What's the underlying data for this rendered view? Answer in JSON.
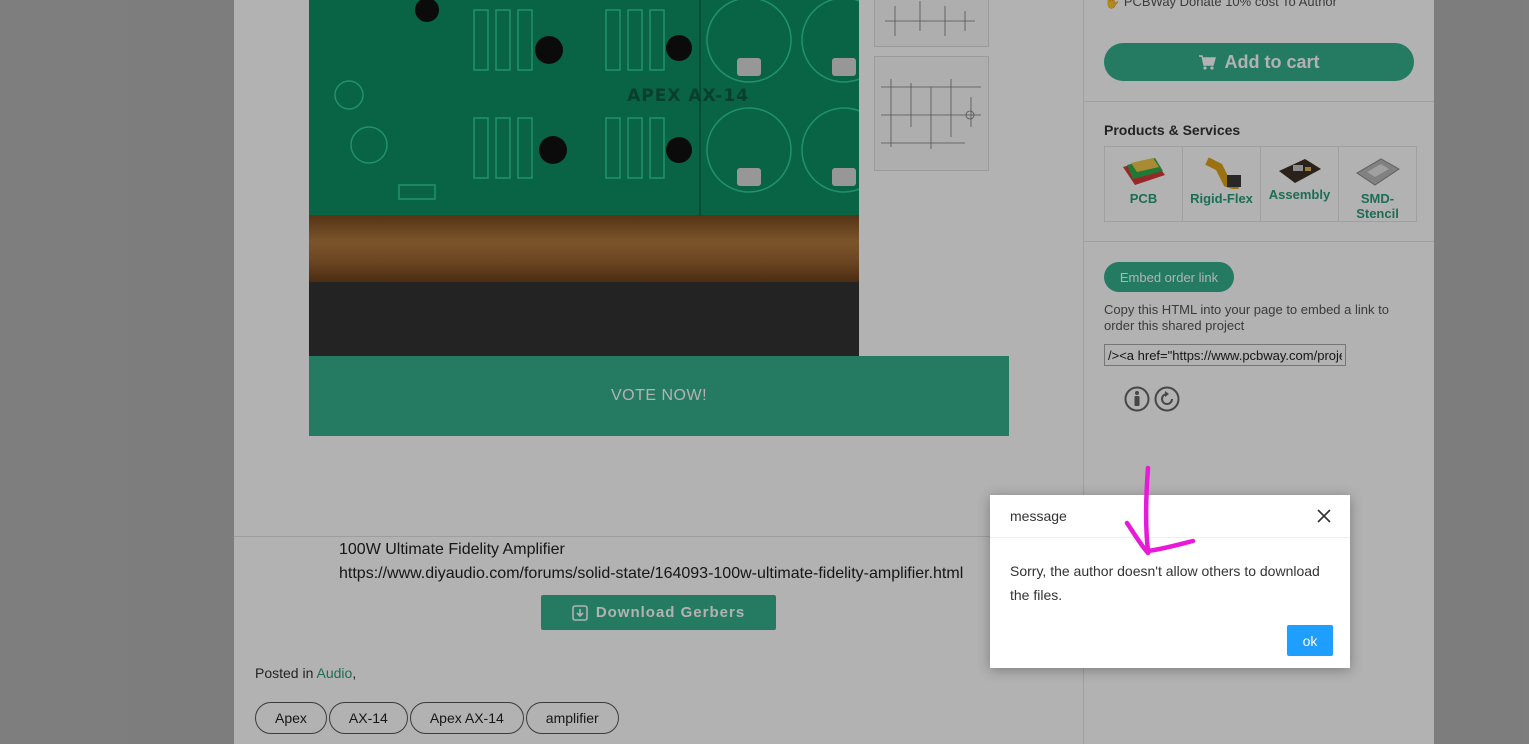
{
  "main": {
    "pcb_silk_text": "APEX AX-14",
    "vote_label": "VOTE NOW!",
    "description_title": "100W Ultimate Fidelity Amplifier",
    "description_link": "https://www.diyaudio.com/forums/solid-state/164093-100w-ultimate-fidelity-amplifier.html",
    "download_label": "Download Gerbers",
    "posted_prefix": "Posted in",
    "posted_category": "Audio",
    "posted_suffix": ",",
    "tags": [
      "Apex",
      "AX-14",
      "Apex AX-14",
      "amplifier"
    ]
  },
  "sidebar": {
    "donate_text": "PCBWay Donate 10% cost To Author",
    "add_to_cart": "Add to cart",
    "products_title": "Products & Services",
    "products": [
      {
        "label": "PCB",
        "icon": "pcb-board-icon"
      },
      {
        "label": "Rigid-Flex",
        "icon": "rigid-flex-icon"
      },
      {
        "label": "Assembly",
        "icon": "assembly-icon"
      },
      {
        "label": "SMD-Stencil",
        "icon": "smd-stencil-icon"
      }
    ],
    "embed_label": "Embed order link",
    "embed_note": "Copy this HTML into your page to embed a link to order this shared project",
    "embed_value": "/><a href=\"https://www.pcbway.com/project/shareproject/"
  },
  "modal": {
    "title": "message",
    "message": "Sorry, the author doesn't allow others to download the files.",
    "ok_label": "ok"
  },
  "colors": {
    "accent": "#34b18c",
    "dialog_button": "#1e9fff",
    "annotation_arrow": "#e81ad7"
  }
}
